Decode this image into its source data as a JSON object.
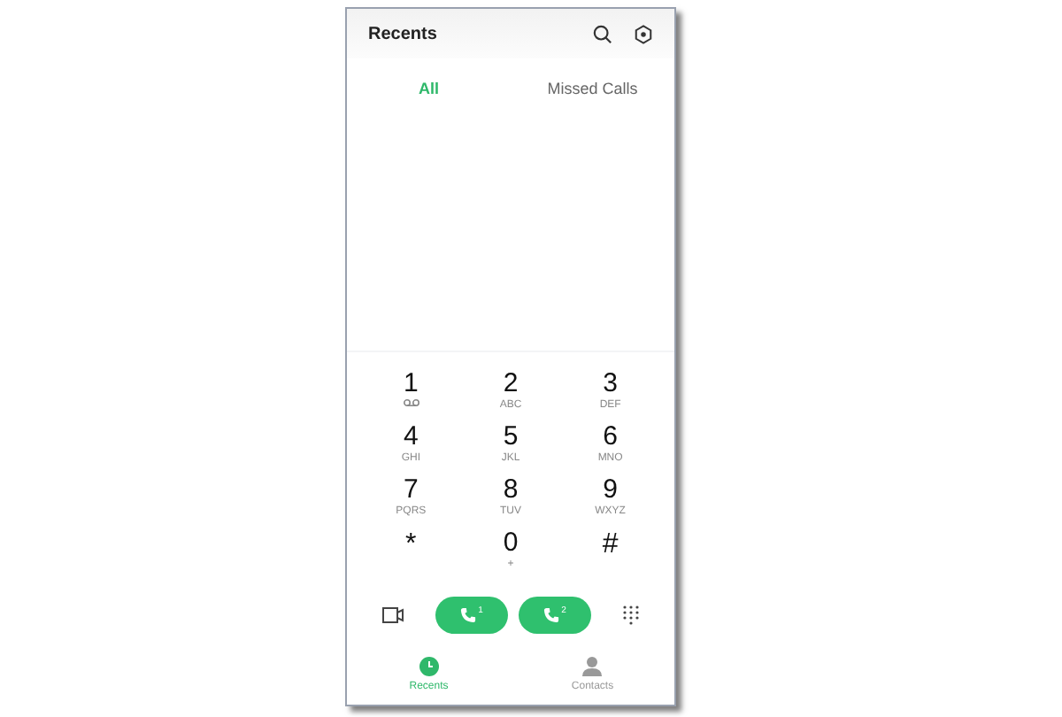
{
  "header": {
    "title": "Recents"
  },
  "tabs": [
    {
      "label": "All",
      "selected": true
    },
    {
      "label": "Missed Calls",
      "selected": false
    }
  ],
  "keypad": [
    {
      "digit": "1",
      "kind": "voicemail"
    },
    {
      "digit": "2",
      "letters": "ABC",
      "kind": "letters"
    },
    {
      "digit": "3",
      "letters": "DEF",
      "kind": "letters"
    },
    {
      "digit": "4",
      "letters": "GHI",
      "kind": "letters"
    },
    {
      "digit": "5",
      "letters": "JKL",
      "kind": "letters"
    },
    {
      "digit": "6",
      "letters": "MNO",
      "kind": "letters"
    },
    {
      "digit": "7",
      "letters": "PQRS",
      "kind": "letters"
    },
    {
      "digit": "8",
      "letters": "TUV",
      "kind": "letters"
    },
    {
      "digit": "9",
      "letters": "WXYZ",
      "kind": "letters"
    },
    {
      "digit": "*",
      "kind": "symbol"
    },
    {
      "digit": "0",
      "letters": "+",
      "kind": "letters"
    },
    {
      "digit": "#",
      "kind": "symbol"
    }
  ],
  "call_buttons": [
    {
      "sim": "1"
    },
    {
      "sim": "2"
    }
  ],
  "bottom_nav": [
    {
      "label": "Recents",
      "selected": true
    },
    {
      "label": "Contacts",
      "selected": false
    }
  ]
}
